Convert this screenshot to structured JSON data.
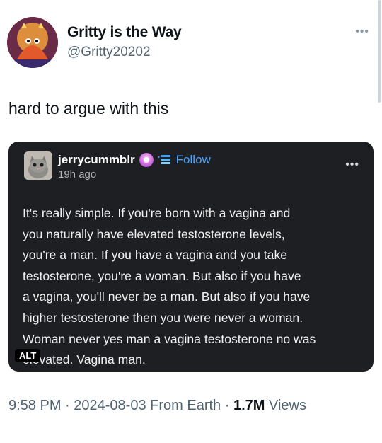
{
  "author": {
    "display_name": "Gritty is the Way",
    "handle": "@Gritty20202"
  },
  "header": {
    "more_icon": "•••"
  },
  "tweet": {
    "text": "hard to argue with this"
  },
  "embed": {
    "username": "jerrycummblr",
    "follow_label": "Follow",
    "time_ago": "19h ago",
    "more_icon": "•••",
    "body_lines": [
      "It's really simple. If you're born with a vagina and",
      "you naturally have elevated testosterone levels,",
      "you're a man. If you have a vagina and you take",
      "testosterone, you're a woman. But also if you have",
      "a vagina, you'll never be a man. But also if you have",
      "higher testosterone then you were never a woman.",
      "Woman never yes man a vagina testosterone no was",
      "elevated. Vagina man."
    ],
    "alt_label": "ALT",
    "colors": {
      "background": "#1e1f22",
      "follow": "#4aa3ff"
    },
    "icons": [
      "badge-icon",
      "stack-icon",
      "more-icon"
    ]
  },
  "meta": {
    "time": "9:58 PM",
    "separator": " · ",
    "date": "2024-08-03",
    "source": "From Earth",
    "views_count": "1.7M",
    "views_label": "Views"
  }
}
